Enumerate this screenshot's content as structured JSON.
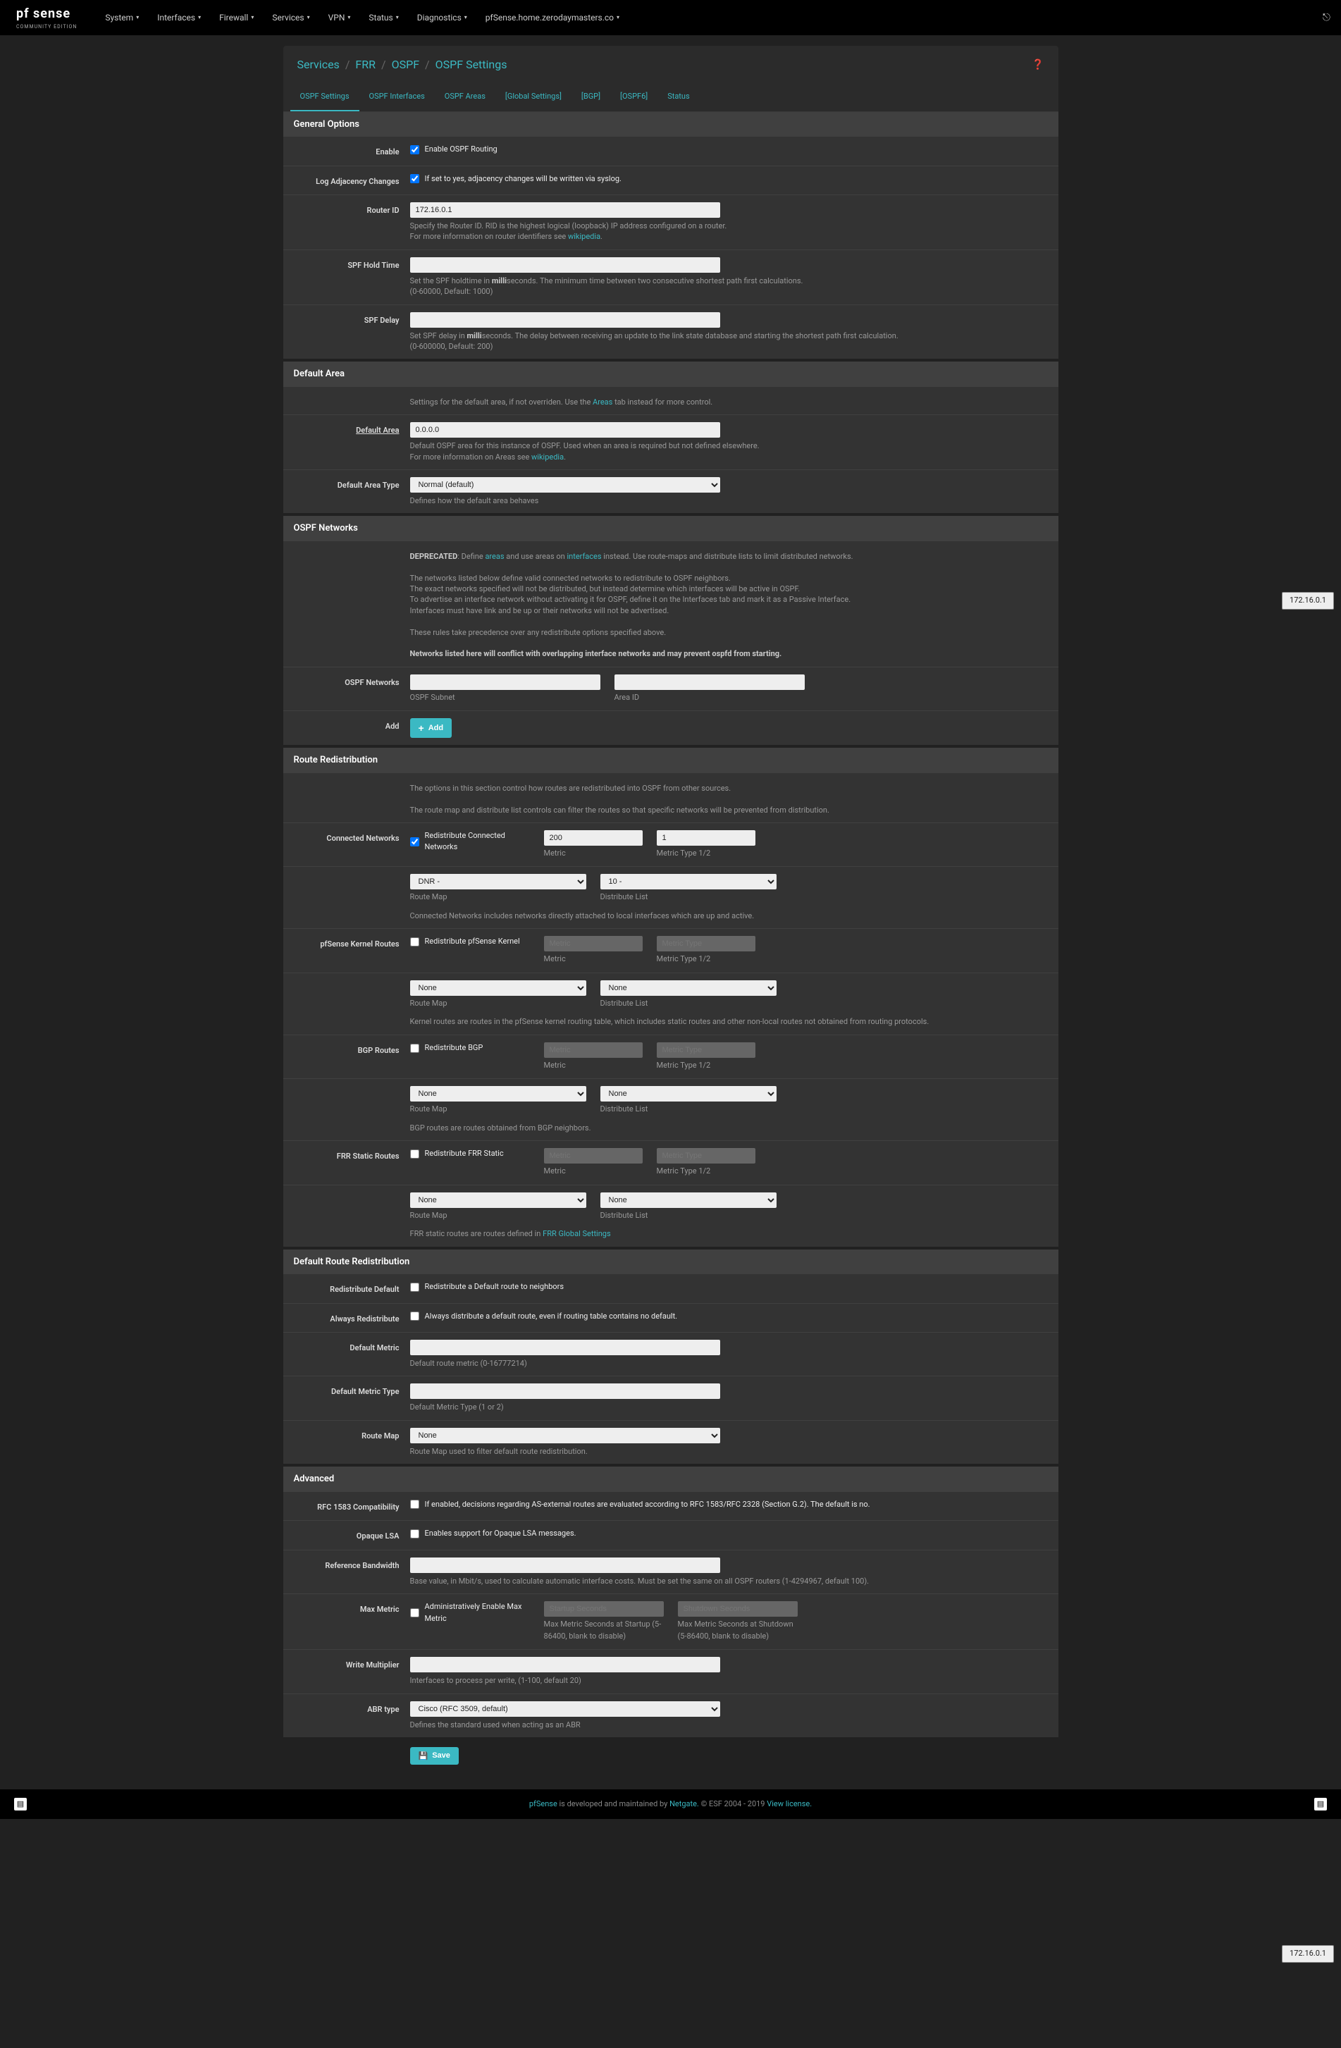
{
  "nav": {
    "brand": "pf sense",
    "sub": "COMMUNITY EDITION",
    "items": [
      "System",
      "Interfaces",
      "Firewall",
      "Services",
      "VPN",
      "Status",
      "Diagnostics"
    ],
    "host": "pfSense.home.zerodaymasters.co"
  },
  "breadcrumb": {
    "a": "Services",
    "b": "FRR",
    "c": "OSPF",
    "d": "OSPF Settings"
  },
  "tabs": [
    "OSPF Settings",
    "OSPF Interfaces",
    "OSPF Areas",
    "[Global Settings]",
    "[BGP]",
    "[OSPF6]",
    "Status"
  ],
  "tooltip": "172.16.0.1",
  "general": {
    "header": "General Options",
    "enable_label": "Enable",
    "enable_desc": "Enable OSPF Routing",
    "log_label": "Log Adjacency Changes",
    "log_desc": "If set to yes, adjacency changes will be written via syslog.",
    "routerid_label": "Router ID",
    "routerid_value": "172.16.0.1",
    "routerid_help1": "Specify the Router ID. RID is the highest logical (loopback) IP address configured on a router.",
    "routerid_help2": "For more information on router identifiers see ",
    "wikipedia": "wikipedia",
    "hold_label": "SPF Hold Time",
    "hold_help1": "Set the SPF holdtime in ",
    "hold_help2": "seconds. The minimum time between two consecutive shortest path first calculations.",
    "hold_help3": "(0-60000, Default: 1000)",
    "delay_label": "SPF Delay",
    "delay_help1": "Set SPF delay in ",
    "delay_help2": "seconds. The delay between receiving an update to the link state database and starting the shortest path first calculation.",
    "delay_help3": "(0-600000, Default: 200)",
    "milli": "milli"
  },
  "defarea": {
    "header": "Default Area",
    "intro1": "Settings for the default area, if not overriden. Use the ",
    "areas": "Areas",
    "intro2": " tab instead for more control.",
    "area_label": "Default Area",
    "area_value": "0.0.0.0",
    "area_help1": "Default OSPF area for this instance of OSPF. Used when an area is required but not defined elsewhere.",
    "area_help2": "For more information on Areas see ",
    "wikipedia": "wikipedia",
    "type_label": "Default Area Type",
    "type_value": "Normal (default)",
    "type_help": "Defines how the default area behaves"
  },
  "ospfnet": {
    "header": "OSPF Networks",
    "dep": "DEPRECATED",
    "dep1": ": Define ",
    "areas": "areas",
    "dep2": " and use areas on ",
    "interfaces": "interfaces",
    "dep3": " instead. Use route-maps and distribute lists to limit distributed networks.",
    "p1": "The networks listed below define valid connected networks to redistribute to OSPF neighbors.",
    "p2": "The exact networks specified will not be distributed, but instead determine which interfaces will be active in OSPF.",
    "p3": "To advertise an interface network without activating it for OSPF, define it on the Interfaces tab and mark it as a Passive Interface.",
    "p4": "Interfaces must have link and be up or their networks will not be advertised.",
    "p5": "These rules take precedence over any redistribute options specified above.",
    "p6": "Networks listed here will conflict with overlapping interface networks and may prevent ospfd from starting.",
    "net_label": "OSPF Networks",
    "subnet": "OSPF Subnet",
    "areaid": "Area ID",
    "add_label": "Add",
    "add_btn": "Add"
  },
  "redist": {
    "header": "Route Redistribution",
    "intro1": "The options in this section control how routes are redistributed into OSPF from other sources.",
    "intro2": "The route map and distribute list controls can filter the routes so that specific networks will be prevented from distribution.",
    "conn_label": "Connected Networks",
    "conn_desc": "Redistribute Connected Networks",
    "metric_val": "200",
    "metric": "Metric",
    "mtype_val": "1",
    "mtype": "Metric Type 1/2",
    "mtype_ph": "Metric Type",
    "metric_ph": "Metric",
    "routemap": "Route Map",
    "distlist": "Distribute List",
    "dnr": "DNR -",
    "ten": "10 -",
    "none": "None",
    "conn_help": "Connected Networks includes networks directly attached to local interfaces which are up and active.",
    "kernel_label": "pfSense Kernel Routes",
    "kernel_desc": "Redistribute pfSense Kernel",
    "kernel_help": "Kernel routes are routes in the pfSense kernel routing table, which includes static routes and other non-local routes not obtained from routing protocols.",
    "bgp_label": "BGP Routes",
    "bgp_desc": "Redistribute BGP",
    "bgp_help": "BGP routes are routes obtained from BGP neighbors.",
    "frr_label": "FRR Static Routes",
    "frr_desc": "Redistribute FRR Static",
    "frr_help": "FRR static routes are routes defined in ",
    "frr_link": "FRR Global Settings"
  },
  "defroute": {
    "header": "Default Route Redistribution",
    "rd_label": "Redistribute Default",
    "rd_desc": "Redistribute a Default route to neighbors",
    "always_label": "Always Redistribute",
    "always_desc": "Always distribute a default route, even if routing table contains no default.",
    "dm_label": "Default Metric",
    "dm_help": "Default route metric (0-16777214)",
    "dmt_label": "Default Metric Type",
    "dmt_help": "Default Metric Type (1 or 2)",
    "rm_label": "Route Map",
    "rm_value": "None",
    "rm_help": "Route Map used to filter default route redistribution."
  },
  "adv": {
    "header": "Advanced",
    "rfc_label": "RFC 1583 Compatibility",
    "rfc_desc": "If enabled, decisions regarding AS-external routes are evaluated according to RFC 1583/RFC 2328 (Section G.2). The default is no.",
    "opaque_label": "Opaque LSA",
    "opaque_desc": "Enables support for Opaque LSA messages.",
    "refbw_label": "Reference Bandwidth",
    "refbw_help": "Base value, in Mbit/s, used to calculate automatic interface costs. Must be set the same on all OSPF routers (1-4294967, default 100).",
    "mm_label": "Max Metric",
    "mm_desc": "Administratively Enable Max Metric",
    "mm_startup_ph": "Startup Seconds",
    "mm_startup_help": "Max Metric Seconds at Startup (5-86400, blank to disable)",
    "mm_shutdown_ph": "Shutdown Seconds",
    "mm_shutdown_help": "Max Metric Seconds at Shutdown (5-86400, blank to disable)",
    "wm_label": "Write Multiplier",
    "wm_help": "Interfaces to process per write, (1-100, default 20)",
    "abr_label": "ABR type",
    "abr_value": "Cisco (RFC 3509, default)",
    "abr_help": "Defines the standard used when acting as an ABR"
  },
  "save": "Save",
  "footer": {
    "p1": "pfSense",
    "p2": " is developed and maintained by ",
    "netgate": "Netgate.",
    "p3": " © ESF 2004 - 2019 ",
    "view": "View license."
  }
}
